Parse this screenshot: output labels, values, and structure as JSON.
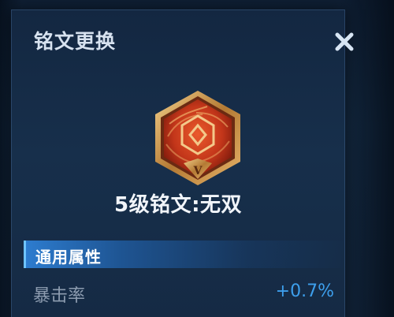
{
  "dialog": {
    "title": "铭文更换",
    "close_icon": "close-x-icon"
  },
  "inscription": {
    "level_prefix": "5级铭文:",
    "name": "无双",
    "tier_numeral": "V",
    "icon": "red-hexagon-inscription-icon",
    "colors": {
      "gem": "#c8391c",
      "frame": "#d6a25a"
    }
  },
  "attributes": {
    "section_title": "通用属性",
    "items": [
      {
        "name": "暴击率",
        "value": "+0.7%"
      }
    ]
  },
  "colors": {
    "panel": "#152a44",
    "accent_bar": "#2e80d6",
    "value_blue": "#3d9fec"
  }
}
